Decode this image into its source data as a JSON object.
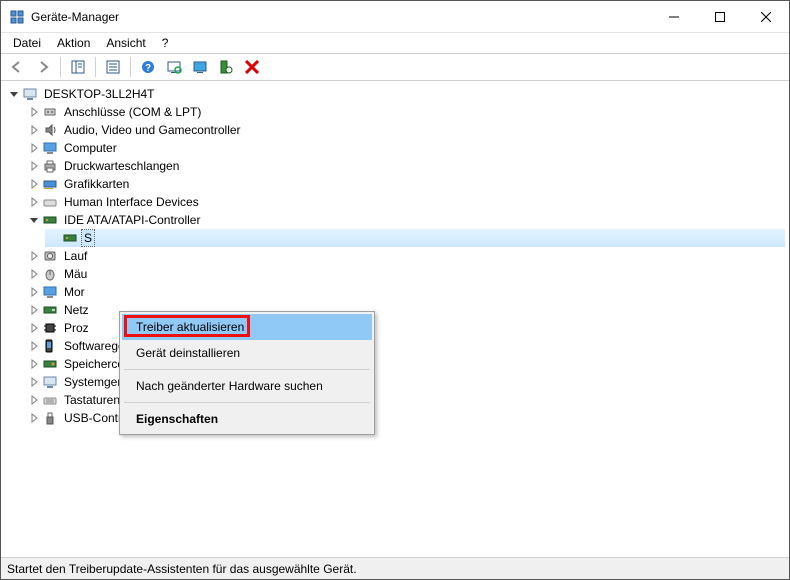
{
  "window": {
    "title": "Geräte-Manager"
  },
  "menu": {
    "file": "Datei",
    "action": "Aktion",
    "view": "Ansicht",
    "help": "?"
  },
  "tree": {
    "root": "DESKTOP-3LL2H4T",
    "categories": {
      "ports": "Anschlüsse (COM & LPT)",
      "audio": "Audio, Video und Gamecontroller",
      "computer": "Computer",
      "printqueues": "Druckwarteschlangen",
      "display": "Grafikkarten",
      "hid": "Human Interface Devices",
      "ide": "IDE ATA/ATAPI-Controller",
      "ide_item": "S",
      "disk": "Lauf",
      "mice": "Mäu",
      "monitors": "Mor",
      "network": "Netz",
      "processors": "Proz",
      "software": "Softwaregeräte",
      "storage": "Speichercontroller",
      "system": "Systemgeräte",
      "keyboards": "Tastaturen",
      "usb": "USB-Controller"
    }
  },
  "context_menu": {
    "update_driver": "Treiber aktualisieren",
    "uninstall": "Gerät deinstallieren",
    "scan_hw": "Nach geänderter Hardware suchen",
    "properties": "Eigenschaften"
  },
  "statusbar": {
    "text": "Startet den Treiberupdate-Assistenten für das ausgewählte Gerät."
  }
}
